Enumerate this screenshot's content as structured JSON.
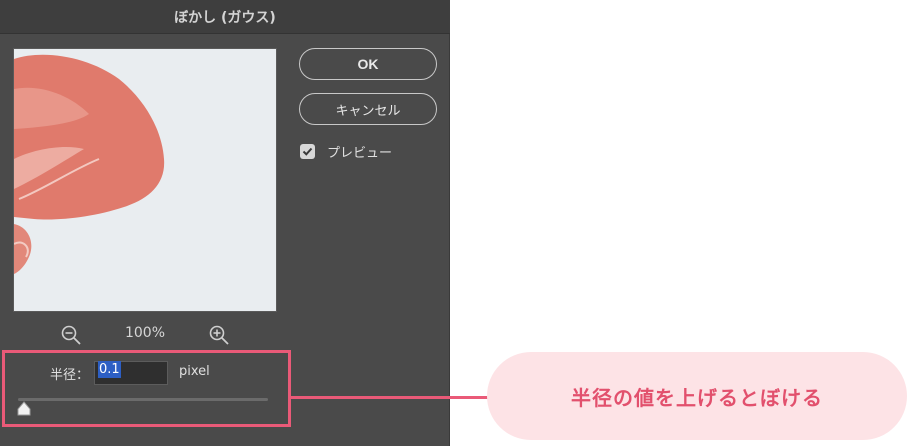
{
  "dialog": {
    "title": "ぼかし (ガウス)",
    "zoom_level": "100%",
    "ok_label": "OK",
    "cancel_label": "キャンセル",
    "preview_label": "プレビュー",
    "preview_checked": true,
    "radius": {
      "label": "半径：",
      "value": "0.1",
      "unit": "pixel",
      "slider_level": 0.0
    },
    "icons": {
      "zoom_out": "zoom-out-icon",
      "zoom_in": "zoom-in-icon",
      "check": "checkmark-icon",
      "slider": "slider-thumb-icon"
    }
  },
  "annotation": {
    "callout_text": "半径の値を上げるとぼける",
    "accent_color": "#ea5a78",
    "callout_bg": "#fde3e6"
  }
}
